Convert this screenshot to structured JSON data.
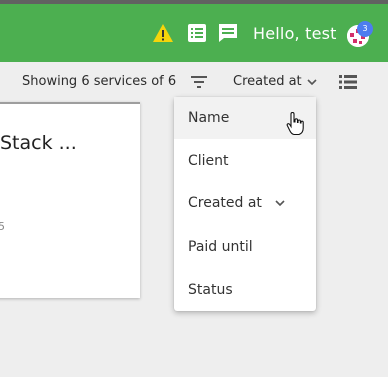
{
  "header": {
    "greeting": "Hello, test",
    "notification_count": "3",
    "icons": [
      "warning-icon",
      "list-icon",
      "message-icon"
    ],
    "colors": {
      "bar": "#4caf50",
      "warning": "#f5d50b",
      "badge": "#4d7cf0"
    }
  },
  "toolbar": {
    "showing_text": "Showing 6 services of 6",
    "sort_label": "Created at",
    "icons": [
      "filter-icon",
      "chevron-down-icon",
      "view-list-icon"
    ]
  },
  "card": {
    "title": "Stack ...",
    "fragment": "5"
  },
  "sort_menu": {
    "items": [
      {
        "label": "Name",
        "hovered": true
      },
      {
        "label": "Client"
      },
      {
        "label": "Created at",
        "selected": true
      },
      {
        "label": "Paid until"
      },
      {
        "label": "Status"
      }
    ]
  }
}
